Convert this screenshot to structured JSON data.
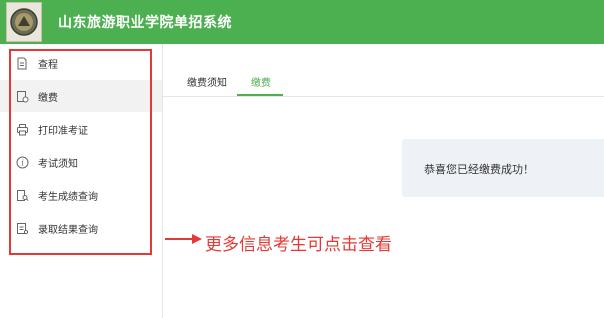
{
  "header": {
    "title": "山东旅游职业学院单招系统"
  },
  "sidebar": {
    "items": [
      {
        "label": "查程",
        "icon": "document-icon"
      },
      {
        "label": "缴费",
        "icon": "payment-icon"
      },
      {
        "label": "打印准考证",
        "icon": "printer-icon"
      },
      {
        "label": "考试须知",
        "icon": "info-icon"
      },
      {
        "label": "考生成绩查询",
        "icon": "score-search-icon"
      },
      {
        "label": "录取结果查询",
        "icon": "admission-search-icon"
      }
    ]
  },
  "tabs": [
    {
      "label": "缴费须知"
    },
    {
      "label": "缴费"
    }
  ],
  "notice": {
    "text": "恭喜您已经缴费成功！"
  },
  "annotation": {
    "text": "更多信息考生可点击查看"
  },
  "colors": {
    "header_bg": "#4caf50",
    "active_tab": "#4caf50",
    "annotation_red": "#e53935"
  }
}
